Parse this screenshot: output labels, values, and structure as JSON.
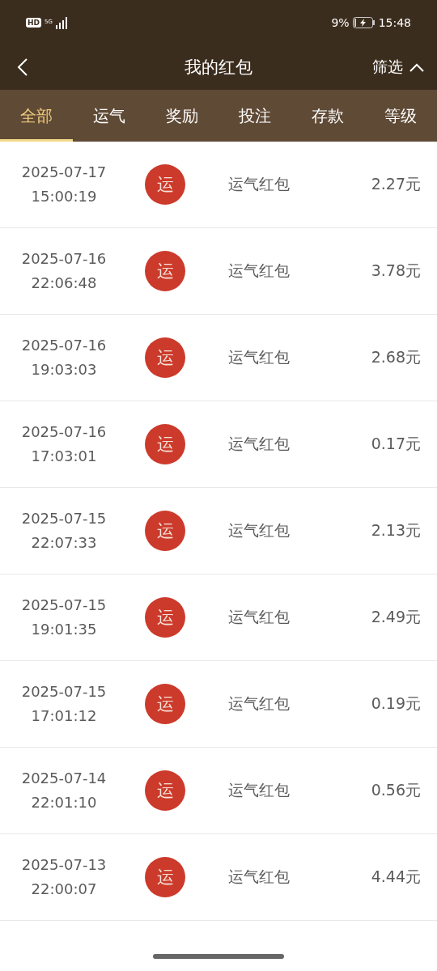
{
  "status_bar": {
    "hd": "HD",
    "network": "5G",
    "battery_percent": "9%",
    "time": "15:48"
  },
  "header": {
    "title": "我的红包",
    "filter": "筛选"
  },
  "tabs": [
    {
      "label": "全部",
      "selected": true
    },
    {
      "label": "运气",
      "selected": false
    },
    {
      "label": "奖励",
      "selected": false
    },
    {
      "label": "投注",
      "selected": false
    },
    {
      "label": "存款",
      "selected": false
    },
    {
      "label": "等级",
      "selected": false
    }
  ],
  "records": [
    {
      "date": "2025-07-17",
      "time": "15:00:19",
      "badge": "运",
      "type": "运气红包",
      "amount": "2.27元"
    },
    {
      "date": "2025-07-16",
      "time": "22:06:48",
      "badge": "运",
      "type": "运气红包",
      "amount": "3.78元"
    },
    {
      "date": "2025-07-16",
      "time": "19:03:03",
      "badge": "运",
      "type": "运气红包",
      "amount": "2.68元"
    },
    {
      "date": "2025-07-16",
      "time": "17:03:01",
      "badge": "运",
      "type": "运气红包",
      "amount": "0.17元"
    },
    {
      "date": "2025-07-15",
      "time": "22:07:33",
      "badge": "运",
      "type": "运气红包",
      "amount": "2.13元"
    },
    {
      "date": "2025-07-15",
      "time": "19:01:35",
      "badge": "运",
      "type": "运气红包",
      "amount": "2.49元"
    },
    {
      "date": "2025-07-15",
      "time": "17:01:12",
      "badge": "运",
      "type": "运气红包",
      "amount": "0.19元"
    },
    {
      "date": "2025-07-14",
      "time": "22:01:10",
      "badge": "运",
      "type": "运气红包",
      "amount": "0.56元"
    },
    {
      "date": "2025-07-13",
      "time": "22:00:07",
      "badge": "运",
      "type": "运气红包",
      "amount": "4.44元"
    }
  ]
}
